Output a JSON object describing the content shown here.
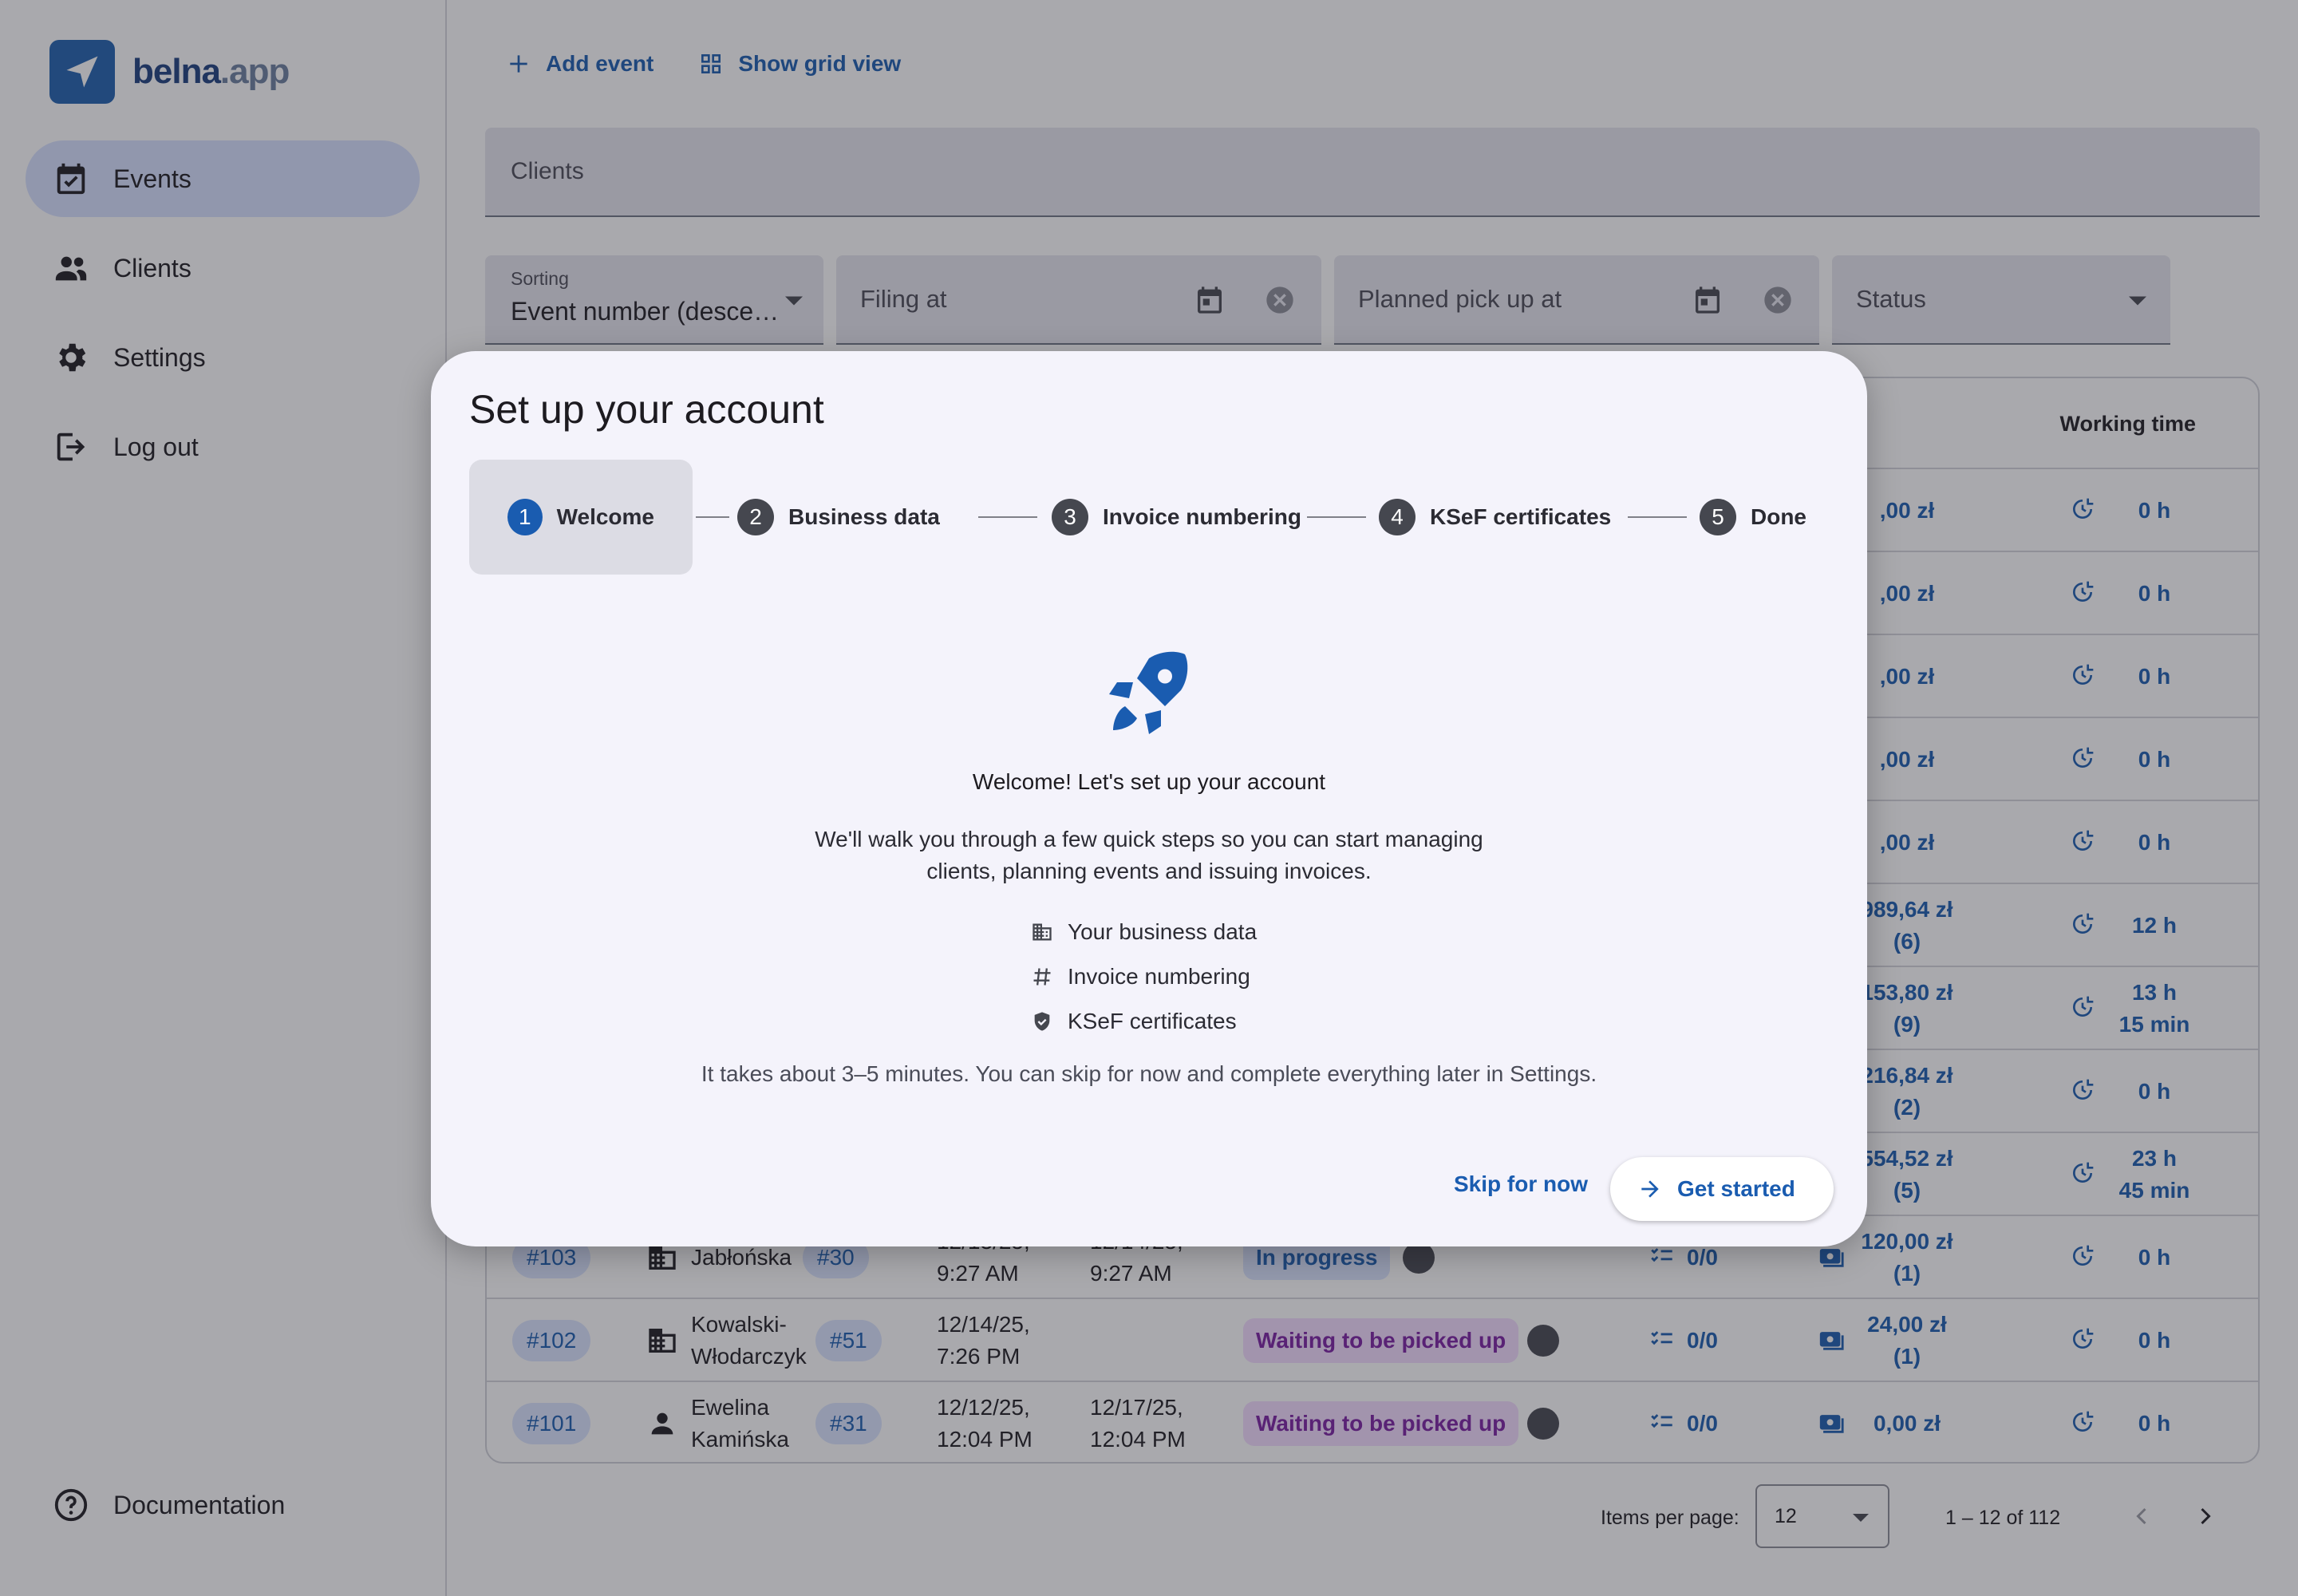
{
  "brand": {
    "name": "belna",
    "tld": ".app",
    "color": "#1f5fae"
  },
  "sidebar": {
    "items": [
      {
        "label": "Events",
        "icon": "calendar-check-icon",
        "active": true
      },
      {
        "label": "Clients",
        "icon": "people-icon"
      },
      {
        "label": "Settings",
        "icon": "gear-icon"
      },
      {
        "label": "Log out",
        "icon": "logout-icon"
      }
    ],
    "documentation": {
      "label": "Documentation",
      "icon": "help-circle-icon"
    }
  },
  "toolbar": {
    "add_event": "Add event",
    "grid_view": "Show grid view"
  },
  "filters": {
    "clients_placeholder": "Clients",
    "sorting_label": "Sorting",
    "sorting_value": "Event number (desce…",
    "filing_at": "Filing at",
    "planned_pickup": "Planned pick up at",
    "status": "Status"
  },
  "table": {
    "working_time_header": "Working time",
    "partial_rows": [
      {
        "amount": ",00 zł",
        "time": "0 h"
      },
      {
        "amount": ",00 zł",
        "time": "0 h"
      },
      {
        "amount": ",00 zł",
        "time": "0 h"
      },
      {
        "amount": ",00 zł",
        "time": "0 h"
      },
      {
        "amount": ",00 zł",
        "time": "0 h"
      },
      {
        "amount": "989,64 zł",
        "count": "(6)",
        "time": "12 h"
      },
      {
        "amount": "153,80 zł",
        "count": "(9)",
        "time": "13 h",
        "time2": "15 min"
      },
      {
        "amount": "216,84 zł",
        "count": "(2)",
        "time": "0 h"
      },
      {
        "amount": "554,52 zł",
        "count": "(5)",
        "time": "23 h",
        "time2": "45 min"
      }
    ],
    "rows": [
      {
        "number": "#103",
        "client": "Jabłońska",
        "client_no": "#30",
        "filing": "12/13/25,",
        "filing_time": "9:27 AM",
        "pickup": "12/14/25,",
        "pickup_time": "9:27 AM",
        "status": "In progress",
        "tasks": "0/0",
        "amount": "120,00 zł",
        "count": "(1)",
        "time": "0 h"
      },
      {
        "number": "#102",
        "client": "Kowalski-",
        "client2": "Włodarczyk",
        "client_no": "#51",
        "filing": "12/14/25,",
        "filing_time": "7:26 PM",
        "pickup": "",
        "pickup_time": "",
        "status": "Waiting to be picked up",
        "tasks": "0/0",
        "amount": "24,00 zł",
        "count": "(1)",
        "time": "0 h"
      },
      {
        "number": "#101",
        "client": "Ewelina",
        "client2": "Kamińska",
        "client_no": "#31",
        "filing": "12/12/25,",
        "filing_time": "12:04 PM",
        "pickup": "12/17/25,",
        "pickup_time": "12:04 PM",
        "status": "Waiting to be picked up",
        "tasks": "0/0",
        "amount": "0,00 zł",
        "count": "",
        "time": "0 h"
      }
    ]
  },
  "pager": {
    "items_per_page_label": "Items per page:",
    "items_per_page": "12",
    "range": "1 – 12 of 112"
  },
  "dialog": {
    "title": "Set up your account",
    "steps": [
      {
        "n": "1",
        "label": "Welcome"
      },
      {
        "n": "2",
        "label": "Business data"
      },
      {
        "n": "3",
        "label": "Invoice numbering"
      },
      {
        "n": "4",
        "label": "KSeF certificates"
      },
      {
        "n": "5",
        "label": "Done"
      }
    ],
    "welcome": "Welcome! Let's set up your account",
    "desc_line1": "We'll walk you through a few quick steps so you can start managing",
    "desc_line2": "clients, planning events and issuing invoices.",
    "bullets": [
      {
        "label": "Your business data",
        "icon": "building-icon"
      },
      {
        "label": "Invoice numbering",
        "icon": "hash-icon"
      },
      {
        "label": "KSeF certificates",
        "icon": "shield-check-icon"
      }
    ],
    "note": "It takes about 3–5 minutes. You can skip for now and complete everything later in Settings.",
    "skip": "Skip for now",
    "start": "Get started"
  }
}
